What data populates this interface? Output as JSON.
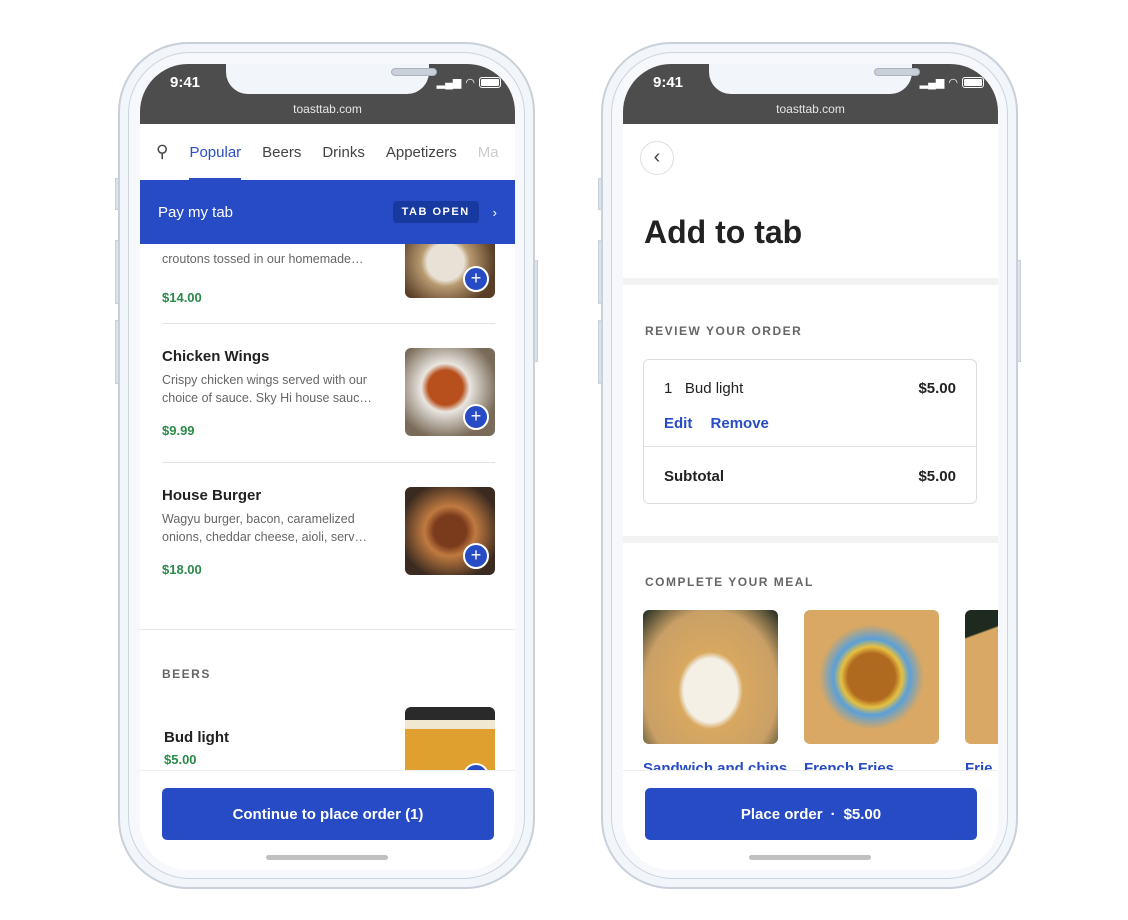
{
  "status": {
    "time": "9:41",
    "url": "toasttab.com"
  },
  "menu_screen": {
    "tabs": [
      "Popular",
      "Beers",
      "Drinks",
      "Appetizers",
      "Ma"
    ],
    "banner": {
      "label": "Pay my tab",
      "badge": "TAB OPEN"
    },
    "items": [
      {
        "desc": "croutons tossed in our homemade…",
        "price": "$14.00"
      },
      {
        "name": "Chicken Wings",
        "desc": "Crispy chicken wings served with our choice of sauce. Sky Hi house sauc…",
        "price": "$9.99"
      },
      {
        "name": "House Burger",
        "desc": "Wagyu burger, bacon, caramelized onions, cheddar cheese, aioli, serv…",
        "price": "$18.00"
      }
    ],
    "beers_section": "BEERS",
    "beer": {
      "name": "Bud light",
      "price": "$5.00"
    },
    "cta": "Continue to place order (1)"
  },
  "order_screen": {
    "title": "Add to tab",
    "review_label": "REVIEW YOUR ORDER",
    "line": {
      "qty": "1",
      "name": "Bud light",
      "price": "$5.00",
      "edit": "Edit",
      "remove": "Remove"
    },
    "subtotal": {
      "label": "Subtotal",
      "value": "$5.00"
    },
    "meal_label": "COMPLETE YOUR MEAL",
    "suggestions": [
      "Sandwich and chips",
      "French Fries",
      "Frie"
    ],
    "cta": "Place order",
    "cta_price": "$5.00"
  },
  "colors": {
    "brand": "#264bc4",
    "price": "#2b8a4a"
  }
}
